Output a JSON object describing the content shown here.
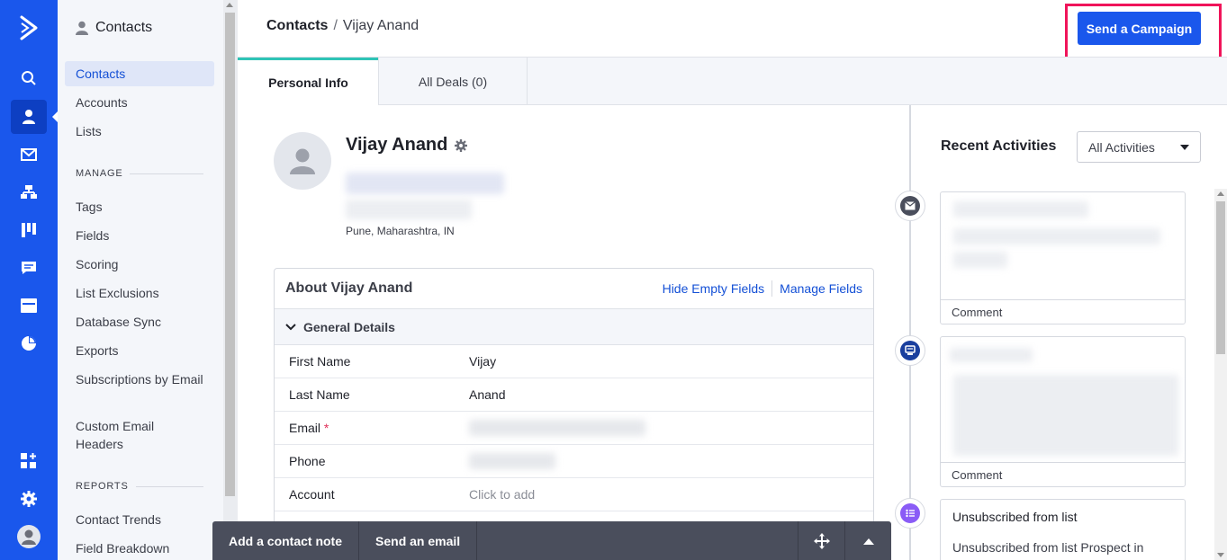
{
  "sidebar": {
    "heading": "Contacts",
    "items": [
      "Contacts",
      "Accounts",
      "Lists"
    ],
    "manage_label": "MANAGE",
    "manage_items": [
      "Tags",
      "Fields",
      "Scoring",
      "List Exclusions",
      "Database Sync",
      "Exports",
      "Subscriptions by Email",
      "Custom Email Headers"
    ],
    "reports_label": "REPORTS",
    "reports_items": [
      "Contact Trends",
      "Field Breakdown"
    ]
  },
  "breadcrumb": {
    "root": "Contacts",
    "separator": "/",
    "current": "Vijay Anand"
  },
  "header": {
    "send_campaign": "Send a Campaign"
  },
  "tabs": [
    "Personal Info",
    "All Deals (0)"
  ],
  "profile": {
    "name": "Vijay Anand",
    "location": "Pune, Maharashtra, IN"
  },
  "about": {
    "title": "About Vijay Anand",
    "hide_empty": "Hide Empty Fields",
    "manage_fields": "Manage Fields",
    "section": "General Details",
    "fields": [
      {
        "label": "First Name",
        "value": "Vijay"
      },
      {
        "label": "Last Name",
        "value": "Anand"
      },
      {
        "label": "Email",
        "required": "*",
        "value": ""
      },
      {
        "label": "Phone",
        "value": ""
      },
      {
        "label": "Account",
        "placeholder": "Click to add"
      }
    ]
  },
  "bottom_bar": {
    "note": "Add a contact note",
    "email": "Send an email"
  },
  "activities": {
    "title": "Recent Activities",
    "filter": "All Activities",
    "items": [
      {
        "footer": "Comment"
      },
      {
        "footer": "Comment"
      },
      {
        "title": "Unsubscribed from list",
        "text": "Unsubscribed from list Prospect in"
      }
    ]
  },
  "colors": {
    "brand": "#1a57ec",
    "highlight": "#f0145a",
    "tab_accent": "#2ec4b6"
  }
}
